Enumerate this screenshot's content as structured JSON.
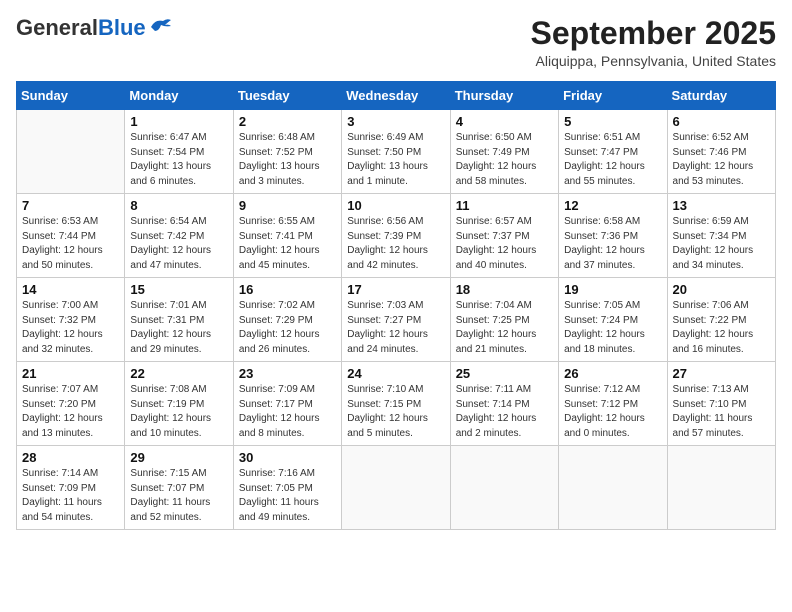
{
  "header": {
    "logo_general": "General",
    "logo_blue": "Blue",
    "month_title": "September 2025",
    "location": "Aliquippa, Pennsylvania, United States"
  },
  "days_of_week": [
    "Sunday",
    "Monday",
    "Tuesday",
    "Wednesday",
    "Thursday",
    "Friday",
    "Saturday"
  ],
  "weeks": [
    [
      {
        "day": "",
        "info": ""
      },
      {
        "day": "1",
        "info": "Sunrise: 6:47 AM\nSunset: 7:54 PM\nDaylight: 13 hours\nand 6 minutes."
      },
      {
        "day": "2",
        "info": "Sunrise: 6:48 AM\nSunset: 7:52 PM\nDaylight: 13 hours\nand 3 minutes."
      },
      {
        "day": "3",
        "info": "Sunrise: 6:49 AM\nSunset: 7:50 PM\nDaylight: 13 hours\nand 1 minute."
      },
      {
        "day": "4",
        "info": "Sunrise: 6:50 AM\nSunset: 7:49 PM\nDaylight: 12 hours\nand 58 minutes."
      },
      {
        "day": "5",
        "info": "Sunrise: 6:51 AM\nSunset: 7:47 PM\nDaylight: 12 hours\nand 55 minutes."
      },
      {
        "day": "6",
        "info": "Sunrise: 6:52 AM\nSunset: 7:46 PM\nDaylight: 12 hours\nand 53 minutes."
      }
    ],
    [
      {
        "day": "7",
        "info": "Sunrise: 6:53 AM\nSunset: 7:44 PM\nDaylight: 12 hours\nand 50 minutes."
      },
      {
        "day": "8",
        "info": "Sunrise: 6:54 AM\nSunset: 7:42 PM\nDaylight: 12 hours\nand 47 minutes."
      },
      {
        "day": "9",
        "info": "Sunrise: 6:55 AM\nSunset: 7:41 PM\nDaylight: 12 hours\nand 45 minutes."
      },
      {
        "day": "10",
        "info": "Sunrise: 6:56 AM\nSunset: 7:39 PM\nDaylight: 12 hours\nand 42 minutes."
      },
      {
        "day": "11",
        "info": "Sunrise: 6:57 AM\nSunset: 7:37 PM\nDaylight: 12 hours\nand 40 minutes."
      },
      {
        "day": "12",
        "info": "Sunrise: 6:58 AM\nSunset: 7:36 PM\nDaylight: 12 hours\nand 37 minutes."
      },
      {
        "day": "13",
        "info": "Sunrise: 6:59 AM\nSunset: 7:34 PM\nDaylight: 12 hours\nand 34 minutes."
      }
    ],
    [
      {
        "day": "14",
        "info": "Sunrise: 7:00 AM\nSunset: 7:32 PM\nDaylight: 12 hours\nand 32 minutes."
      },
      {
        "day": "15",
        "info": "Sunrise: 7:01 AM\nSunset: 7:31 PM\nDaylight: 12 hours\nand 29 minutes."
      },
      {
        "day": "16",
        "info": "Sunrise: 7:02 AM\nSunset: 7:29 PM\nDaylight: 12 hours\nand 26 minutes."
      },
      {
        "day": "17",
        "info": "Sunrise: 7:03 AM\nSunset: 7:27 PM\nDaylight: 12 hours\nand 24 minutes."
      },
      {
        "day": "18",
        "info": "Sunrise: 7:04 AM\nSunset: 7:25 PM\nDaylight: 12 hours\nand 21 minutes."
      },
      {
        "day": "19",
        "info": "Sunrise: 7:05 AM\nSunset: 7:24 PM\nDaylight: 12 hours\nand 18 minutes."
      },
      {
        "day": "20",
        "info": "Sunrise: 7:06 AM\nSunset: 7:22 PM\nDaylight: 12 hours\nand 16 minutes."
      }
    ],
    [
      {
        "day": "21",
        "info": "Sunrise: 7:07 AM\nSunset: 7:20 PM\nDaylight: 12 hours\nand 13 minutes."
      },
      {
        "day": "22",
        "info": "Sunrise: 7:08 AM\nSunset: 7:19 PM\nDaylight: 12 hours\nand 10 minutes."
      },
      {
        "day": "23",
        "info": "Sunrise: 7:09 AM\nSunset: 7:17 PM\nDaylight: 12 hours\nand 8 minutes."
      },
      {
        "day": "24",
        "info": "Sunrise: 7:10 AM\nSunset: 7:15 PM\nDaylight: 12 hours\nand 5 minutes."
      },
      {
        "day": "25",
        "info": "Sunrise: 7:11 AM\nSunset: 7:14 PM\nDaylight: 12 hours\nand 2 minutes."
      },
      {
        "day": "26",
        "info": "Sunrise: 7:12 AM\nSunset: 7:12 PM\nDaylight: 12 hours\nand 0 minutes."
      },
      {
        "day": "27",
        "info": "Sunrise: 7:13 AM\nSunset: 7:10 PM\nDaylight: 11 hours\nand 57 minutes."
      }
    ],
    [
      {
        "day": "28",
        "info": "Sunrise: 7:14 AM\nSunset: 7:09 PM\nDaylight: 11 hours\nand 54 minutes."
      },
      {
        "day": "29",
        "info": "Sunrise: 7:15 AM\nSunset: 7:07 PM\nDaylight: 11 hours\nand 52 minutes."
      },
      {
        "day": "30",
        "info": "Sunrise: 7:16 AM\nSunset: 7:05 PM\nDaylight: 11 hours\nand 49 minutes."
      },
      {
        "day": "",
        "info": ""
      },
      {
        "day": "",
        "info": ""
      },
      {
        "day": "",
        "info": ""
      },
      {
        "day": "",
        "info": ""
      }
    ]
  ]
}
